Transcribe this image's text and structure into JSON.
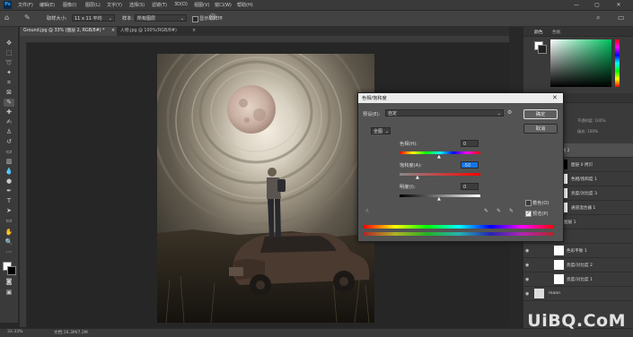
{
  "app": {
    "logo": "Ps"
  },
  "menu": [
    "文件(F)",
    "编辑(E)",
    "图像(I)",
    "图层(L)",
    "文字(Y)",
    "选择(S)",
    "滤镜(T)",
    "3D(D)",
    "视图(V)",
    "窗口(W)",
    "帮助(H)"
  ],
  "window_controls": [
    "—",
    "▢",
    "✕"
  ],
  "options": {
    "sample_size_label": "取样大小:",
    "sample_size_value": "11 x 11 平均",
    "sample_label": "样本:",
    "sample_value": "所有图层",
    "show_ring_label": "显示取样环"
  },
  "doc_tabs": [
    {
      "title": "Ground.jpg @ 33% (图层 2, RGB/8#) *",
      "close": "×"
    },
    {
      "title": "人物.jpg @ 100%(RGB/8#)",
      "close": "×"
    }
  ],
  "statusbar": {
    "zoom": "33.33%",
    "doc": "文档:16.3M/7.2M"
  },
  "dialog": {
    "title": "色相/饱和度",
    "preset_label": "预设(E):",
    "preset_value": "自定",
    "channel_value": "全图",
    "hue_label": "色相(H):",
    "hue_value": "0",
    "saturation_label": "饱和度(A):",
    "saturation_value": "-50",
    "lightness_label": "明度(I):",
    "lightness_value": "0",
    "ok": "确定",
    "cancel": "取消",
    "colorize": "着色(O)",
    "preview": "预览(P)",
    "colorize_checked": false,
    "preview_checked": true
  },
  "panels": {
    "color_tab": "颜色",
    "swatches_tab": "色板",
    "layers_tab": "图层",
    "paths_tab": "路径",
    "opacity_label": "不透明度: 100%",
    "fill_label": "填充: 100%"
  },
  "layers": [
    {
      "name": "图层 2"
    },
    {
      "name": "图层 0 拷贝"
    },
    {
      "name": "色相/饱和度 1"
    },
    {
      "name": "亮度/对比度 3"
    },
    {
      "name": "通道混合器 1"
    },
    {
      "name": "图层 1"
    },
    {
      "name": "图层 0"
    },
    {
      "name": "色彩平衡 1"
    },
    {
      "name": "亮度/对比度 2"
    },
    {
      "name": "亮度/对比度 1"
    },
    {
      "name": "moon"
    }
  ],
  "watermark": "UiBQ.CoM",
  "colors": {
    "accent": "#1473e6",
    "ps_blue": "#31a8ff",
    "dialog_bg": "#535353"
  }
}
